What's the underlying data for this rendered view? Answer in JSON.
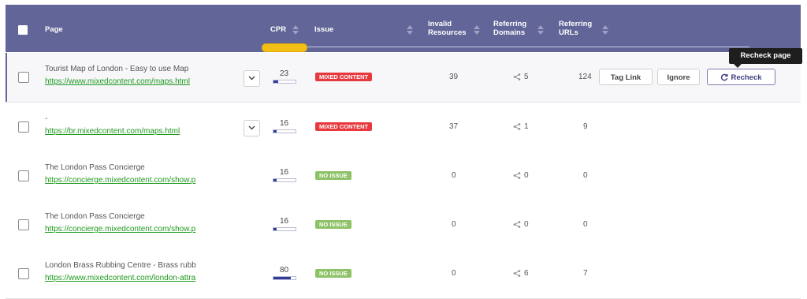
{
  "header": {
    "page": "Page",
    "cpr": "CPR",
    "issue": "Issue",
    "invalid_resources": [
      "Invalid",
      "Resources"
    ],
    "referring_domains": [
      "Referring",
      "Domains"
    ],
    "referring_urls": [
      "Referring",
      "URLs"
    ]
  },
  "rows": [
    {
      "title": "Tourist Map of London - Easy to use Map",
      "url": "https://www.mixedcontent.com/maps.html",
      "cpr": "23",
      "issue": "MIXED CONTENT",
      "invalid": "39",
      "ref_domains": "5",
      "ref_urls": "124"
    },
    {
      "title": "-",
      "url": "https://br.mixedcontent.com/maps.html",
      "cpr": "16",
      "issue": "MIXED CONTENT",
      "invalid": "37",
      "ref_domains": "1",
      "ref_urls": "9"
    },
    {
      "title": "The London Pass Concierge",
      "url": "https://concierge.mixedcontent.com/show.p",
      "cpr": "16",
      "issue": "NO ISSUE",
      "invalid": "0",
      "ref_domains": "0",
      "ref_urls": "0"
    },
    {
      "title": "The London Pass Concierge",
      "url": "https://concierge.mixedcontent.com/show.p",
      "cpr": "16",
      "issue": "NO ISSUE",
      "invalid": "0",
      "ref_domains": "0",
      "ref_urls": "0"
    },
    {
      "title": "London Brass Rubbing Centre - Brass rubb",
      "url": "https://www.mixedcontent.com/london-attra",
      "cpr": "80",
      "issue": "NO ISSUE",
      "invalid": "0",
      "ref_domains": "6",
      "ref_urls": "7"
    }
  ],
  "actions": {
    "tag_link": "Tag Link",
    "ignore": "Ignore",
    "recheck": "Recheck"
  },
  "tooltip": "Recheck page",
  "colors": {
    "header_bg": "#626597",
    "mixed_content": "#e8393e",
    "no_issue": "#8dc267",
    "url_green": "#1f9a1f",
    "cpr_highlight": "#f2c014"
  }
}
